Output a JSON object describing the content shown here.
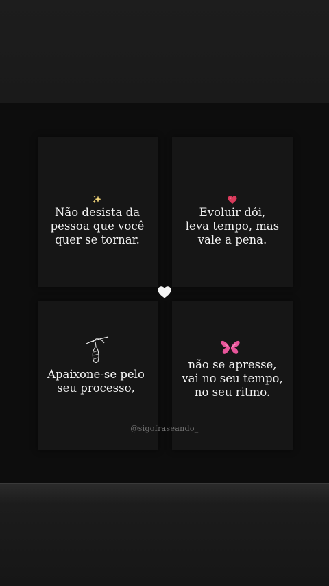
{
  "post": {
    "cards": [
      {
        "icon": "sparkles-icon",
        "text": "Não desista da\npessoa que você\nquer se tornar."
      },
      {
        "icon": "red-heart-icon",
        "text": "Evoluir dói,\nleva tempo, mas\nvale a pena."
      },
      {
        "icon": "cocoon-branch-icon",
        "text": "Apaixone-se pelo\nseu processo,"
      },
      {
        "icon": "pink-butterfly-icon",
        "text": "não se apresse,\nvai no seu tempo,\nno seu ritmo."
      }
    ],
    "center_icon": "white-heart-icon",
    "watermark": "@sigofraseando_"
  },
  "colors": {
    "background": "#1a1a1a",
    "post_background": "#0d0d0d",
    "card_background": "#161616",
    "text": "#f2f2f2",
    "watermark": "#6f6f6f",
    "heart_red": "#d93a5b",
    "butterfly_pink": "#e8559a"
  }
}
